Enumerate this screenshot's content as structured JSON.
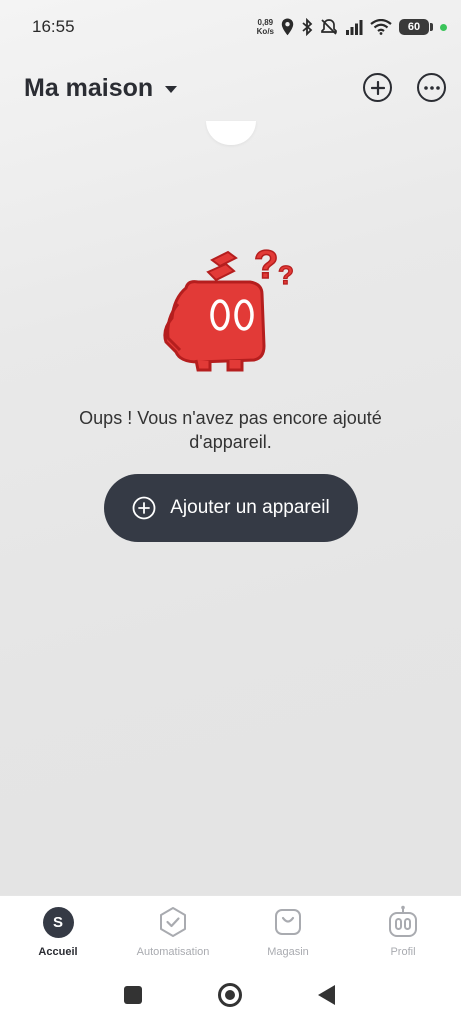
{
  "status_bar": {
    "time": "16:55",
    "net_speed_value": "0,89",
    "net_speed_unit": "Ko/s",
    "battery": "60",
    "icons": [
      "location-icon",
      "bluetooth-icon",
      "mute-icon",
      "signal-icon",
      "wifi-icon",
      "battery-icon"
    ]
  },
  "header": {
    "title": "Ma maison",
    "add_icon": "plus-circle-icon",
    "more_icon": "more-dots-icon"
  },
  "empty_state": {
    "message": "Oups ! Vous n'avez pas encore ajouté d'appareil.",
    "add_button_label": "Ajouter un appareil",
    "mascot_eyes": "00"
  },
  "bottom_nav": {
    "items": [
      {
        "label": "Accueil",
        "icon": "home-s-icon",
        "badge": "S",
        "active": true
      },
      {
        "label": "Automatisation",
        "icon": "automation-shield-icon",
        "active": false
      },
      {
        "label": "Magasin",
        "icon": "shopping-bag-icon",
        "active": false
      },
      {
        "label": "Profil",
        "icon": "robot-profile-icon",
        "active": false
      }
    ]
  },
  "colors": {
    "primary_dark": "#353a45",
    "mascot_red": "#e23a37",
    "inactive_gray": "#a9abb0"
  }
}
